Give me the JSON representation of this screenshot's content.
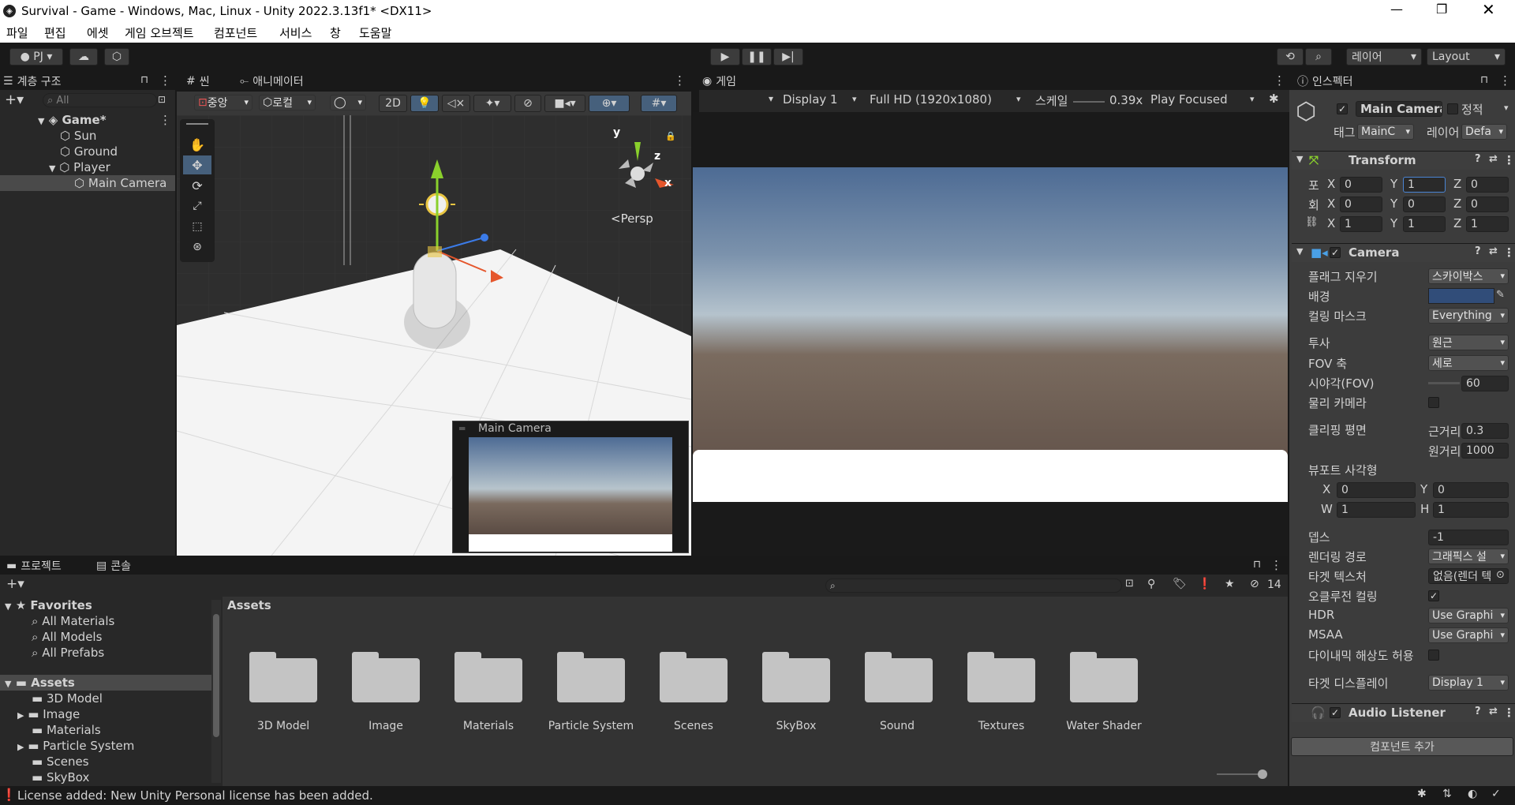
{
  "window": {
    "title": "Survival - Game - Windows, Mac, Linux - Unity 2022.3.13f1* <DX11>"
  },
  "menu": [
    "파일",
    "편집",
    "에셋",
    "게임 오브젝트",
    "컴포넌트",
    "서비스",
    "창",
    "도움말"
  ],
  "toolbar": {
    "account": "PJ",
    "layers": "레이어",
    "layout": "Layout"
  },
  "hierarchy": {
    "tab": "계층 구조",
    "search_placeholder": "All",
    "scene": "Game*",
    "items": [
      "Sun",
      "Ground",
      "Player",
      "Main Camera"
    ]
  },
  "scene": {
    "tab_scene": "씬",
    "tab_animator": "애니메이터",
    "pivot": "중앙",
    "space": "로컬",
    "mode2d": "2D",
    "persp": "<Persp",
    "axis_y": "y",
    "axis_z": "z",
    "axis_x": "x",
    "preview_title": "Main Camera"
  },
  "game": {
    "tab": "게임",
    "display": "Display 1",
    "resolution": "Full HD (1920x1080)",
    "scale_label": "스케일",
    "scale_value": "0.39x",
    "play_mode": "Play Focused"
  },
  "inspector": {
    "tab": "인스펙터",
    "object_name": "Main Camera",
    "static_label": "정적",
    "tag_label": "태그",
    "tag_value": "MainC",
    "layer_label": "레이어",
    "layer_value": "Defa",
    "transform": {
      "title": "Transform",
      "pos_label": "포",
      "rot_label": "회",
      "position": {
        "x": "0",
        "y": "1",
        "z": "0"
      },
      "rotation": {
        "x": "0",
        "y": "0",
        "z": "0"
      },
      "scale": {
        "x": "1",
        "y": "1",
        "z": "1"
      }
    },
    "camera": {
      "title": "Camera",
      "clear_flags_label": "플래그 지우기",
      "clear_flags": "스카이박스",
      "background_label": "배경",
      "background_color": "#314d79",
      "culling_label": "컬링 마스크",
      "culling": "Everything",
      "projection_label": "투사",
      "projection": "원근",
      "fov_axis_label": "FOV 축",
      "fov_axis": "세로",
      "fov_label": "시야각(FOV)",
      "fov": "60",
      "physical_label": "물리 카메라",
      "clipping_label": "클리핑 평면",
      "near_label": "근거리",
      "near": "0.3",
      "far_label": "원거리",
      "far": "1000",
      "viewport_label": "뷰포트 사각형",
      "vp_x": "0",
      "vp_y": "0",
      "vp_w": "1",
      "vp_h": "1",
      "depth_label": "뎁스",
      "depth": "-1",
      "render_path_label": "렌더링 경로",
      "render_path": "그래픽스 설",
      "target_tex_label": "타겟 텍스처",
      "target_tex": "없음(렌더 텍",
      "occlusion_label": "오클루전 컬링",
      "hdr_label": "HDR",
      "hdr": "Use Graphi",
      "msaa_label": "MSAA",
      "msaa": "Use Graphi",
      "dynres_label": "다이내믹 해상도 허용",
      "target_display_label": "타겟 디스플레이",
      "target_display": "Display 1"
    },
    "audio_listener": {
      "title": "Audio Listener"
    },
    "add_component": "컴포넌트 추가"
  },
  "project": {
    "tab_project": "프로젝트",
    "tab_console": "콘솔",
    "hidden_count": "14",
    "favorites": "Favorites",
    "favorites_items": [
      "All Materials",
      "All Models",
      "All Prefabs"
    ],
    "assets_label": "Assets",
    "tree": [
      "3D Model",
      "Image",
      "Materials",
      "Particle System",
      "Scenes",
      "SkyBox"
    ],
    "breadcrumb": "Assets",
    "folders": [
      "3D Model",
      "Image",
      "Materials",
      "Particle System",
      "Scenes",
      "SkyBox",
      "Sound",
      "Textures",
      "Water Shader"
    ]
  },
  "status": {
    "message": "License added: New Unity Personal license has been added."
  }
}
